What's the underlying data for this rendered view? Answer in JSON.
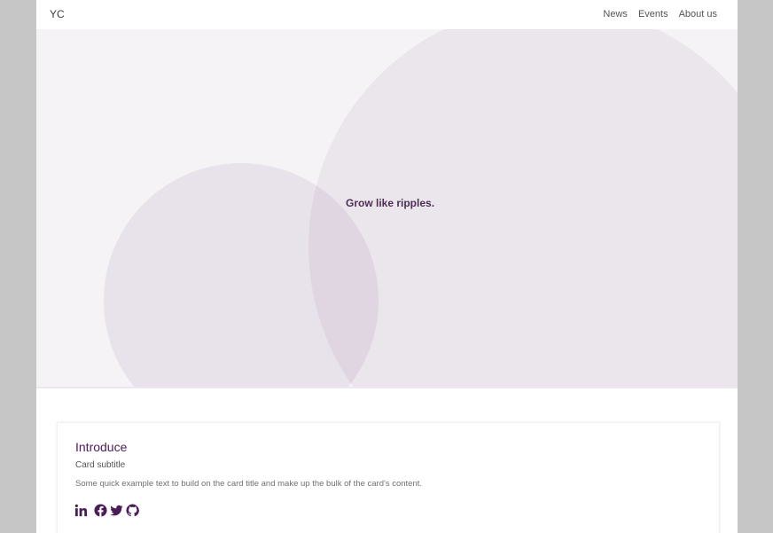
{
  "navbar": {
    "brand": "YC",
    "links": [
      "News",
      "Events",
      "About us"
    ]
  },
  "hero": {
    "tagline": "Grow like ripples."
  },
  "card": {
    "title": "Introduce",
    "subtitle": "Card subtitle",
    "text": "Some quick example text to build on the card title and make up the bulk of the card's content.",
    "social_icons": [
      "linkedin-icon",
      "facebook-icon",
      "twitter-icon",
      "github-icon"
    ]
  },
  "colors": {
    "accent": "#4a1d57",
    "hero_bg": "#f5f3f6",
    "ripple": "#e6dee9"
  }
}
